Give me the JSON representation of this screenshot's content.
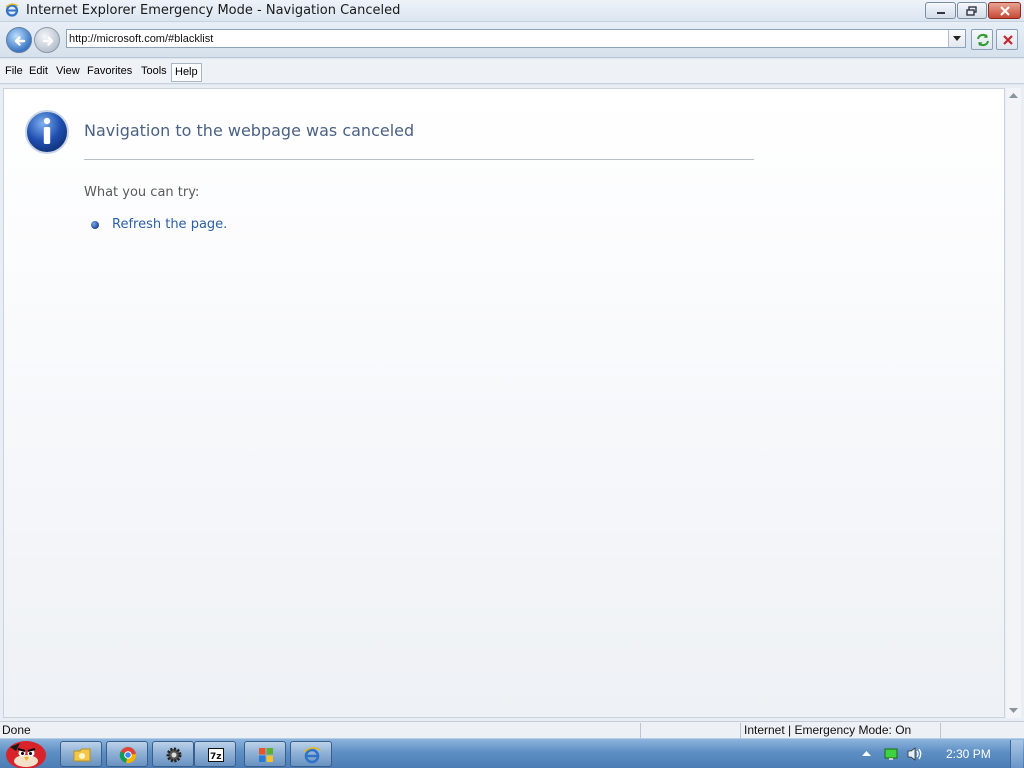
{
  "window": {
    "title": "Internet Explorer Emergency Mode - Navigation Canceled"
  },
  "address_bar": {
    "url": "http://microsoft.com/#blacklist"
  },
  "menu": {
    "items": [
      "File",
      "Edit",
      "View",
      "Favorites",
      "Tools",
      "Help"
    ],
    "active": "Help"
  },
  "page": {
    "heading": "Navigation to the webpage was canceled",
    "try_label": "What you can try:",
    "suggestions": [
      "Refresh the page."
    ]
  },
  "status_bar": {
    "text": "Done",
    "zone": "Internet | Emergency Mode: On"
  },
  "taskbar": {
    "clock": "2:30 PM",
    "pinned": [
      "folder-icon",
      "chrome-icon",
      "gear-icon",
      "7zip-icon",
      "windows-flag-icon",
      "internet-explorer-icon"
    ]
  },
  "colors": {
    "heading": "#4b6183",
    "link": "#2c60a6",
    "taskbar": "#5e8fc4"
  }
}
